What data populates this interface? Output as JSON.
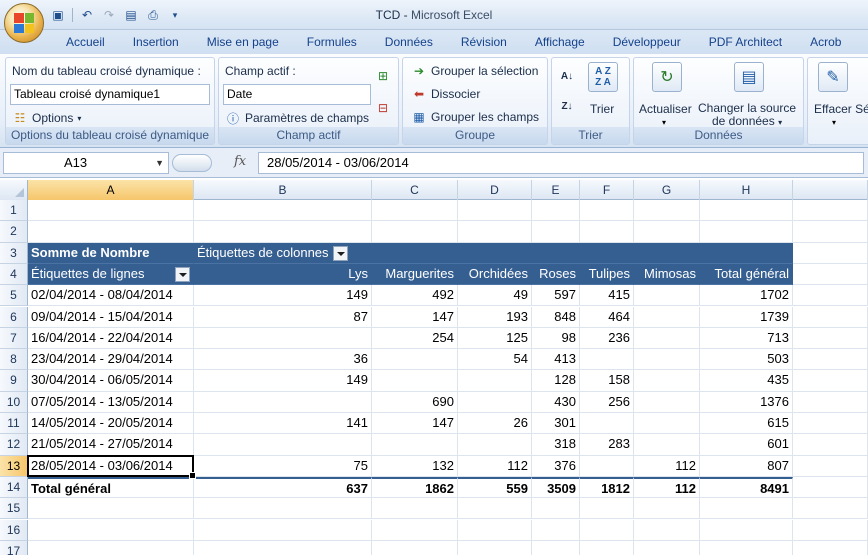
{
  "window": {
    "title_doc": "TCD",
    "title_sep": " - ",
    "title_app": "Microsoft Excel"
  },
  "qat": [
    "save-icon",
    "undo-icon",
    "redo-icon",
    "print-preview-icon",
    "print-icon",
    "customize-icon"
  ],
  "tabs": [
    "Accueil",
    "Insertion",
    "Mise en page",
    "Formules",
    "Données",
    "Révision",
    "Affichage",
    "Développeur",
    "PDF Architect",
    "Acrob"
  ],
  "ribbon": {
    "pivot_name_label": "Nom du tableau croisé dynamique :",
    "pivot_name_value": "Tableau croisé dynamique1",
    "options_label": "Options",
    "group1_label": "Options du tableau croisé dynamique",
    "active_field_label": "Champ actif :",
    "active_field_value": "Date",
    "field_settings_label": "Paramètres de champs",
    "group2_label": "Champ actif",
    "group_selection_label": "Grouper la sélection",
    "ungroup_label": "Dissocier",
    "group_field_label": "Grouper les champs",
    "group3_label": "Groupe",
    "sort_label": "Trier",
    "sort_az": "A Z",
    "sort_za": "Z A",
    "group4_label": "Trier",
    "refresh_label": "Actualiser",
    "change_source_line1": "Changer la source",
    "change_source_line2": "de données",
    "group5_label": "Données",
    "clear_label": "Effacer",
    "select_label": "Sé"
  },
  "formula_bar": {
    "name_box": "A13",
    "fx": "fx",
    "formula": "28/05/2014 - 03/06/2014"
  },
  "columns": [
    "A",
    "B",
    "C",
    "D",
    "E",
    "F",
    "G",
    "H"
  ],
  "rows": [
    "1",
    "2",
    "3",
    "4",
    "5",
    "6",
    "7",
    "8",
    "9",
    "10",
    "11",
    "12",
    "13",
    "14",
    "15",
    "16",
    "17"
  ],
  "pivot": {
    "values_label": "Somme de Nombre",
    "column_labels": "Étiquettes de colonnes",
    "row_labels": "Étiquettes de lignes",
    "headers": [
      "Lys",
      "Marguerites",
      "Orchidées",
      "Roses",
      "Tulipes",
      "Mimosas",
      "Total général"
    ],
    "data": [
      {
        "label": "02/04/2014 - 08/04/2014",
        "values": [
          "149",
          "492",
          "49",
          "597",
          "415",
          "",
          "1702"
        ]
      },
      {
        "label": "09/04/2014 - 15/04/2014",
        "values": [
          "87",
          "147",
          "193",
          "848",
          "464",
          "",
          "1739"
        ]
      },
      {
        "label": "16/04/2014 - 22/04/2014",
        "values": [
          "",
          "254",
          "125",
          "98",
          "236",
          "",
          "713"
        ]
      },
      {
        "label": "23/04/2014 - 29/04/2014",
        "values": [
          "36",
          "",
          "54",
          "413",
          "",
          "",
          "503"
        ]
      },
      {
        "label": "30/04/2014 - 06/05/2014",
        "values": [
          "149",
          "",
          "",
          "128",
          "158",
          "",
          "435"
        ]
      },
      {
        "label": "07/05/2014 - 13/05/2014",
        "values": [
          "",
          "690",
          "",
          "430",
          "256",
          "",
          "1376"
        ]
      },
      {
        "label": "14/05/2014 - 20/05/2014",
        "values": [
          "141",
          "147",
          "26",
          "301",
          "",
          "",
          "615"
        ]
      },
      {
        "label": "21/05/2014 - 27/05/2014",
        "values": [
          "",
          "",
          "",
          "318",
          "283",
          "",
          "601"
        ]
      },
      {
        "label": "28/05/2014 - 03/06/2014",
        "values": [
          "75",
          "132",
          "112",
          "376",
          "",
          "112",
          "807"
        ]
      }
    ],
    "total_label": "Total général",
    "totals": [
      "637",
      "1862",
      "559",
      "3509",
      "1812",
      "112",
      "8491"
    ]
  }
}
